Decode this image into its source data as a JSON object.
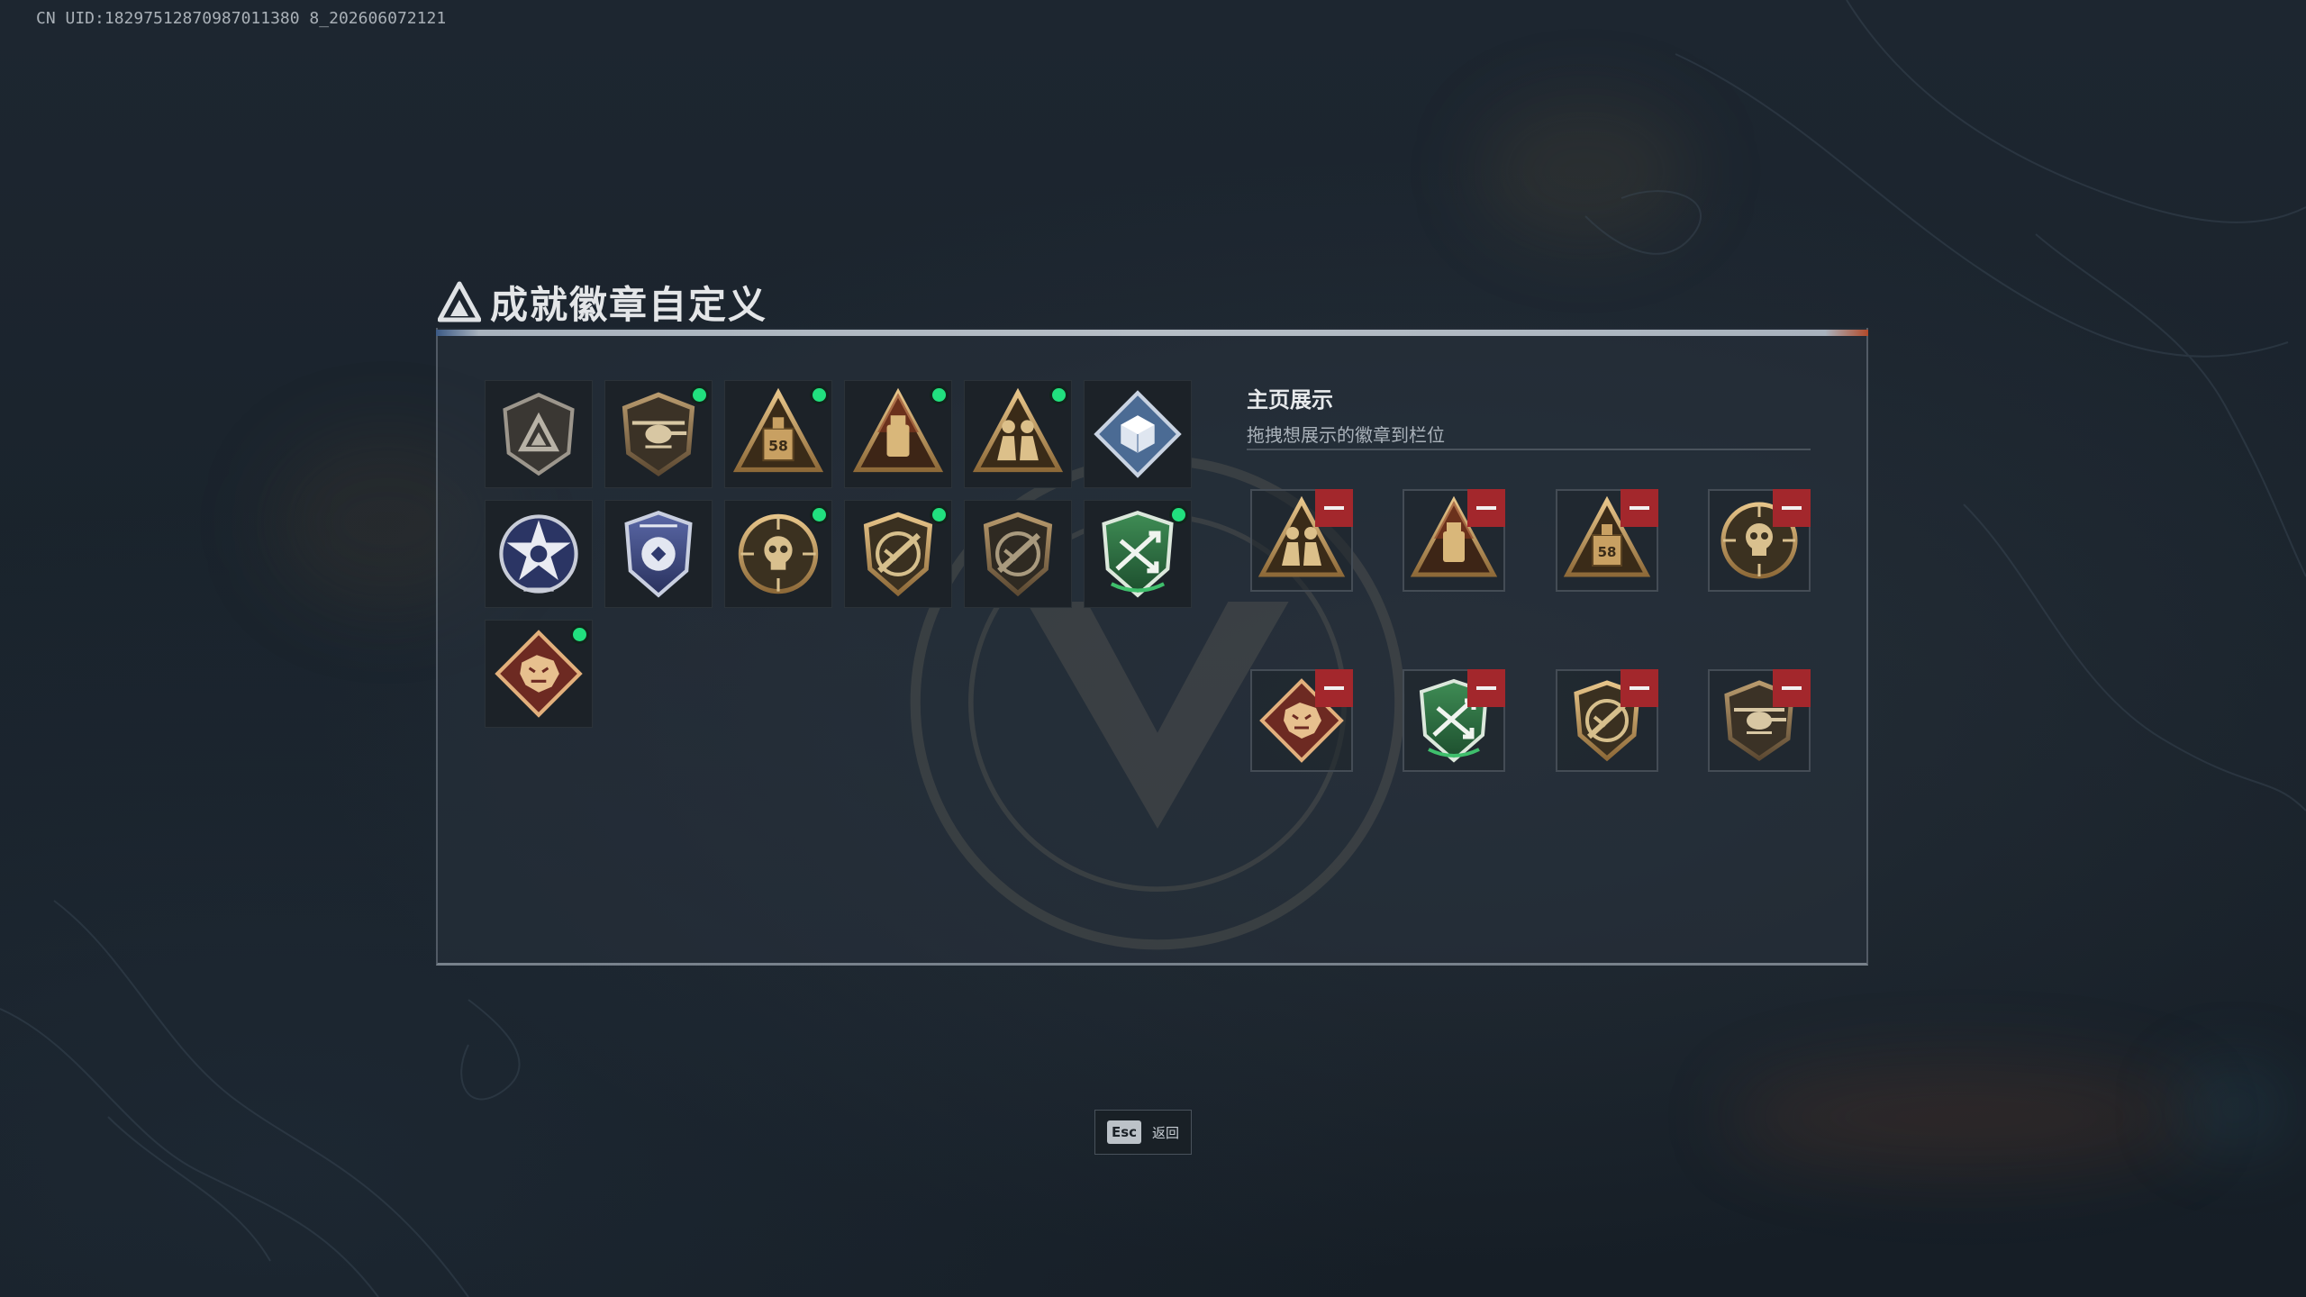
{
  "uid_text": "CN UID:18297512870987011380 8_202606072121",
  "title": "成就徽章自定义",
  "title_small": "",
  "display": {
    "title": "主页展示",
    "subtitle": "拖拽想展示的徽章到栏位"
  },
  "badges": [
    {
      "icon": "gray-triangle-shield-badge-icon",
      "new": false
    },
    {
      "icon": "helicopter-shield-badge-icon",
      "new": true
    },
    {
      "icon": "tank-58-triangle-badge-icon",
      "new": true
    },
    {
      "icon": "robot-triangle-badge-icon",
      "new": true
    },
    {
      "icon": "soldiers-triangle-badge-icon",
      "new": true
    },
    {
      "icon": "cube-diamond-badge-icon",
      "new": false
    },
    {
      "icon": "star-wreath-badge-icon",
      "new": false
    },
    {
      "icon": "blue-shield-badge-icon",
      "new": false
    },
    {
      "icon": "skull-crosshair-badge-icon",
      "new": true
    },
    {
      "icon": "rifle-shield-badge-icon",
      "new": true
    },
    {
      "icon": "rifle-shield-dim-badge-icon",
      "new": false
    },
    {
      "icon": "green-arrows-shield-badge-icon",
      "new": true
    },
    {
      "icon": "dragon-diamond-badge-icon",
      "new": true
    }
  ],
  "display_slots": [
    {
      "icon": "soldiers-triangle-badge-icon"
    },
    {
      "icon": "robot-triangle-badge-icon"
    },
    {
      "icon": "tank-58-triangle-badge-icon"
    },
    {
      "icon": "skull-crosshair-badge-icon"
    },
    {
      "icon": "dragon-diamond-badge-icon"
    },
    {
      "icon": "green-arrows-shield-badge-icon"
    },
    {
      "icon": "rifle-shield-badge-icon"
    },
    {
      "icon": "helicopter-shield-badge-icon"
    }
  ],
  "esc": {
    "key": "Esc",
    "label": "返回"
  },
  "colors": {
    "accent_green": "#21e07e",
    "remove_red": "#a3272c",
    "gold": "#c8a062"
  }
}
